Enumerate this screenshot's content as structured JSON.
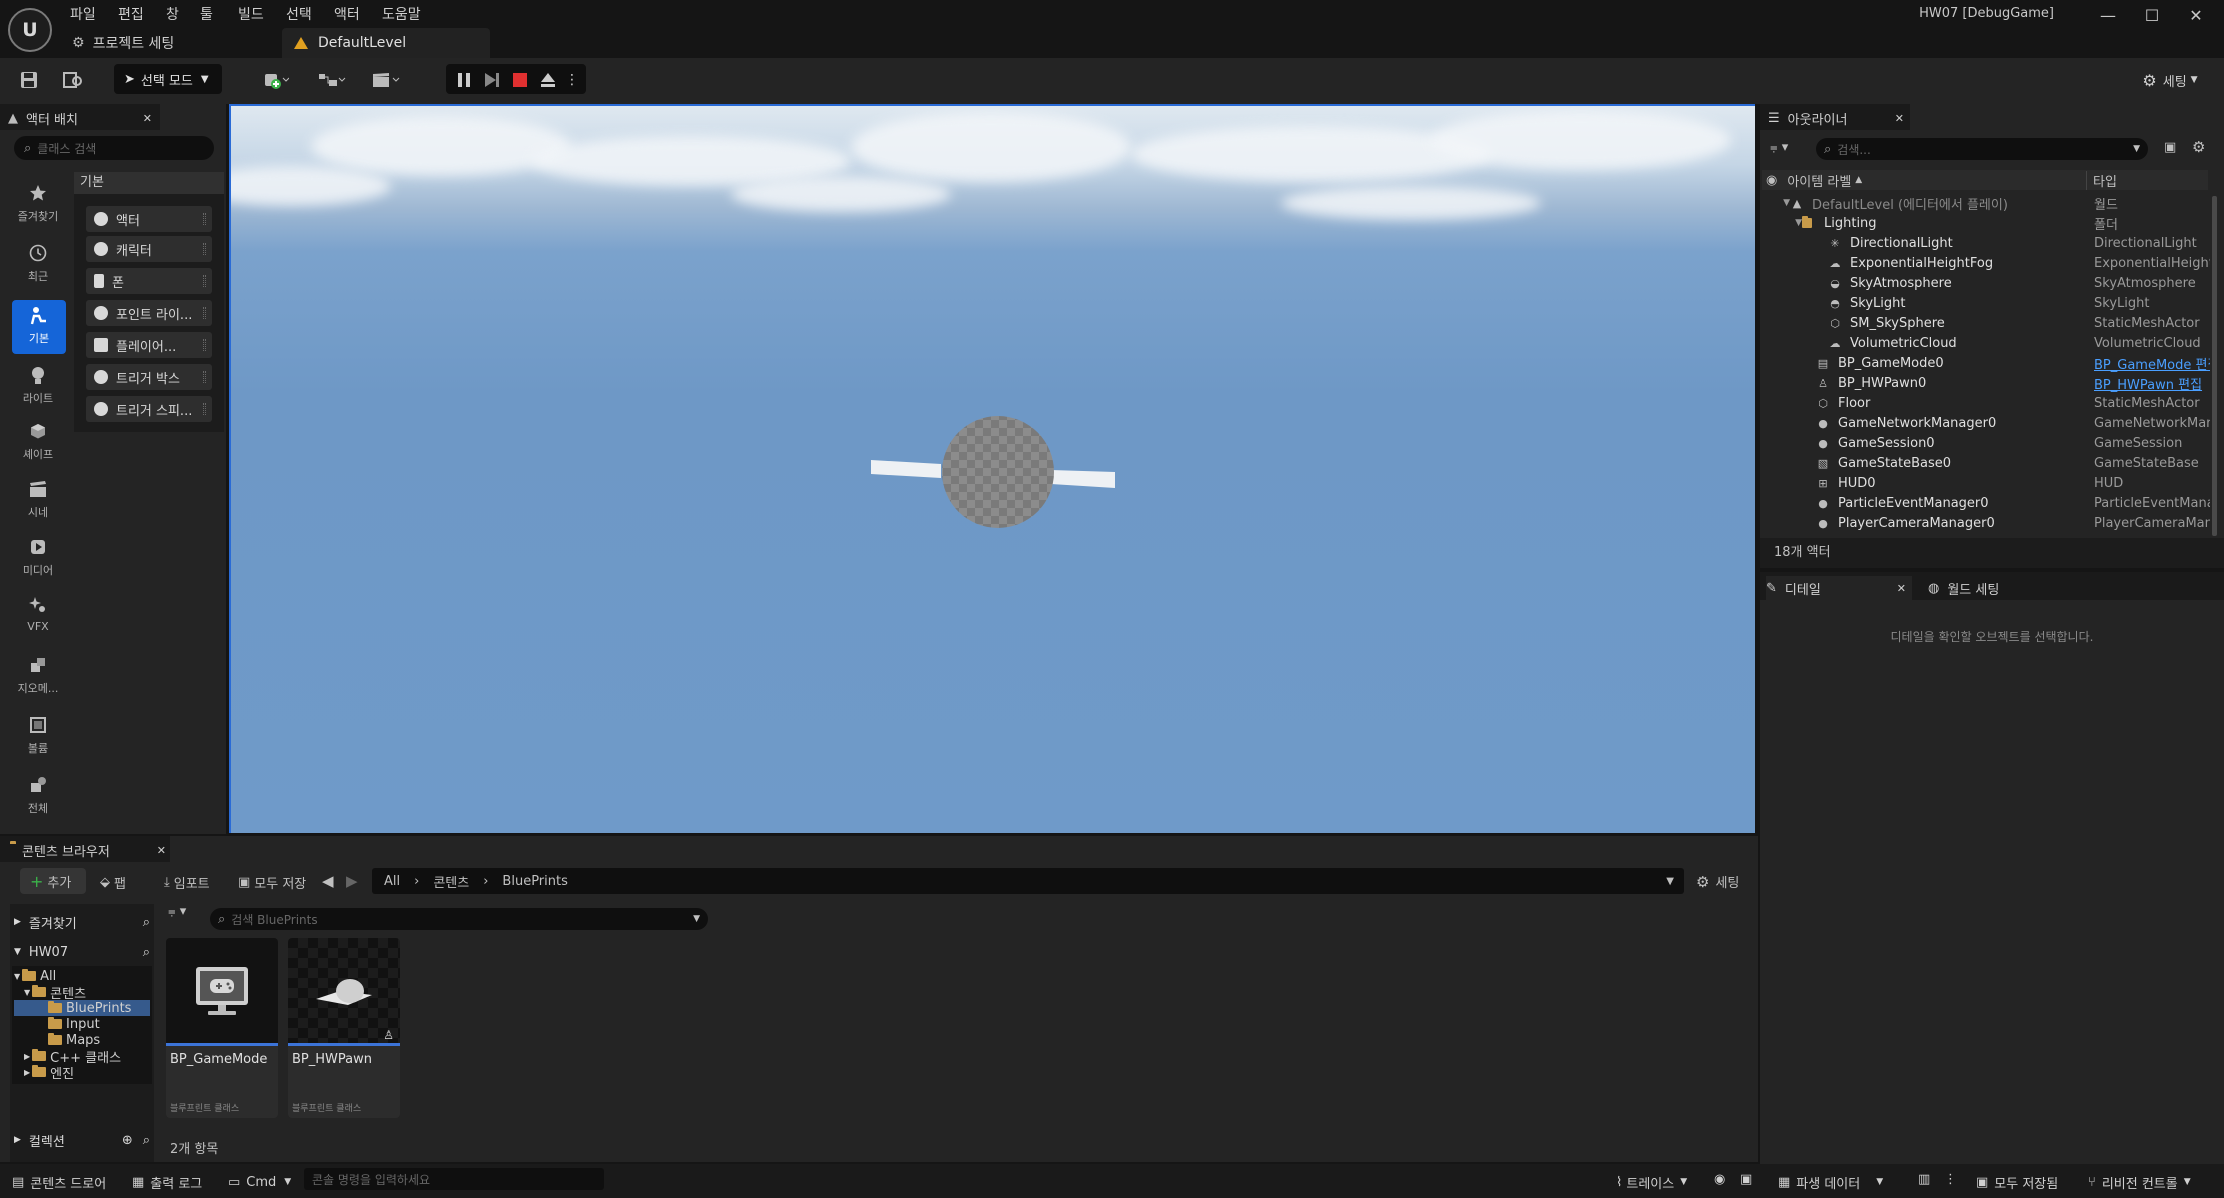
{
  "window": {
    "title": "HW07 [DebugGame]",
    "logo_text": "U"
  },
  "menu": [
    "파일",
    "편집",
    "창",
    "툴",
    "빌드",
    "선택",
    "액터",
    "도움말"
  ],
  "tabs": {
    "project_settings": "프로젝트 세팅",
    "level": "DefaultLevel"
  },
  "toolbar": {
    "mode": "선택 모드",
    "settings": "세팅"
  },
  "place_actors": {
    "tab": "액터 배치",
    "search_placeholder": "클래스 검색",
    "category_header": "기본",
    "categories": [
      "즐겨찾기",
      "최근",
      "기본",
      "라이트",
      "셰이프",
      "시네",
      "미디어",
      "VFX",
      "지오메...",
      "볼륨",
      "전체"
    ],
    "items": [
      "액터",
      "캐릭터",
      "폰",
      "포인트 라이...",
      "플레이어...",
      "트리거 박스",
      "트리거 스피..."
    ]
  },
  "outliner": {
    "tab": "아웃라이너",
    "search_placeholder": "검색...",
    "col_label": "아이템 라벨",
    "col_type": "타입",
    "rows": [
      {
        "name": "DefaultLevel (에디터에서 플레이)",
        "type": "월드"
      },
      {
        "name": "Lighting",
        "type": "폴더"
      },
      {
        "name": "DirectionalLight",
        "type": "DirectionalLight"
      },
      {
        "name": "ExponentialHeightFog",
        "type": "ExponentialHeightFog"
      },
      {
        "name": "SkyAtmosphere",
        "type": "SkyAtmosphere"
      },
      {
        "name": "SkyLight",
        "type": "SkyLight"
      },
      {
        "name": "SM_SkySphere",
        "type": "StaticMeshActor"
      },
      {
        "name": "VolumetricCloud",
        "type": "VolumetricCloud"
      },
      {
        "name": "BP_GameMode0",
        "type": "BP_GameMode 편집"
      },
      {
        "name": "BP_HWPawn0",
        "type": "BP_HWPawn 편집"
      },
      {
        "name": "Floor",
        "type": "StaticMeshActor"
      },
      {
        "name": "GameNetworkManager0",
        "type": "GameNetworkManager"
      },
      {
        "name": "GameSession0",
        "type": "GameSession"
      },
      {
        "name": "GameStateBase0",
        "type": "GameStateBase"
      },
      {
        "name": "HUD0",
        "type": "HUD"
      },
      {
        "name": "ParticleEventManager0",
        "type": "ParticleEventManager"
      },
      {
        "name": "PlayerCameraManager0",
        "type": "PlayerCameraManager"
      }
    ],
    "count": "18개 액터"
  },
  "details": {
    "tab": "디테일",
    "world_tab": "월드 세팅",
    "empty_msg": "디테일을 확인할 오브젝트를 선택합니다."
  },
  "content_browser": {
    "tab": "콘텐츠 브라우저",
    "add": "추가",
    "import": "임포트",
    "fab": "팹",
    "save_all": "모두 저장",
    "breadcrumb": [
      "All",
      "콘텐츠",
      "BluePrints"
    ],
    "settings": "세팅",
    "favorites": "즐겨찾기",
    "project": "HW07",
    "tree": [
      "All",
      "콘텐츠",
      "BluePrints",
      "Input",
      "Maps",
      "C++ 클래스",
      "엔진"
    ],
    "search_placeholder": "검색 BluePrints",
    "assets": [
      {
        "name": "BP_GameMode",
        "kind": "블루프린트 클래스"
      },
      {
        "name": "BP_HWPawn",
        "kind": "블루프린트 클래스"
      }
    ],
    "item_count": "2개 항목",
    "collections": "컬렉션"
  },
  "statusbar": {
    "content_drawer": "콘텐츠 드로어",
    "output_log": "출력 로그",
    "cmd": "Cmd",
    "cmd_placeholder": "콘솔 명령을 입력하세요",
    "trace": "트레이스",
    "derived_data": "파생 데이터",
    "all_saved": "모두 저장됨",
    "revision_control": "리비전 컨트롤"
  }
}
